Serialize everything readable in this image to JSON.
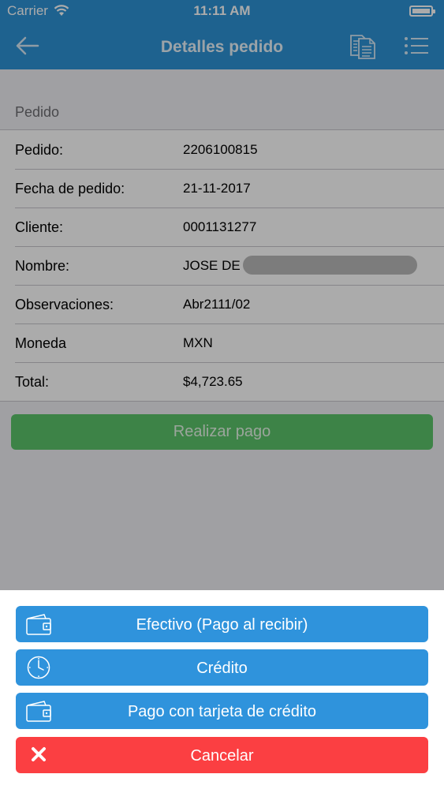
{
  "status_bar": {
    "carrier": "Carrier",
    "time": "11:11 AM"
  },
  "navbar": {
    "title": "Detalles pedido",
    "icons": [
      "back-arrow-icon",
      "document-icon",
      "list-menu-icon"
    ]
  },
  "section": {
    "title": "Pedido"
  },
  "details": [
    {
      "label": "Pedido:",
      "value": "2206100815"
    },
    {
      "label": "Fecha de pedido:",
      "value": "21-11-2017"
    },
    {
      "label": "Cliente:",
      "value": "0001131277"
    },
    {
      "label": "Nombre:",
      "value": "JOSE DE"
    },
    {
      "label": "Observaciones:",
      "value": "Abr2111/02"
    },
    {
      "label": "Moneda",
      "value": "MXN"
    },
    {
      "label": "Total:",
      "value": "$4,723.65"
    }
  ],
  "pay_button": {
    "label": "Realizar pago",
    "color": "#5cc46a"
  },
  "action_sheet": {
    "options": [
      {
        "label": "Efectivo (Pago al recibir)",
        "icon": "wallet-icon"
      },
      {
        "label": "Crédito",
        "icon": "clock-icon"
      },
      {
        "label": "Pago con tarjeta de crédito",
        "icon": "wallet-icon"
      }
    ],
    "cancel": {
      "label": "Cancelar",
      "icon": "close-icon",
      "color": "#fb3f42"
    }
  },
  "colors": {
    "primary": "#2e93d6",
    "button_blue": "#2f93dc",
    "cancel_red": "#fb3f42",
    "pay_green": "#5cc46a"
  }
}
